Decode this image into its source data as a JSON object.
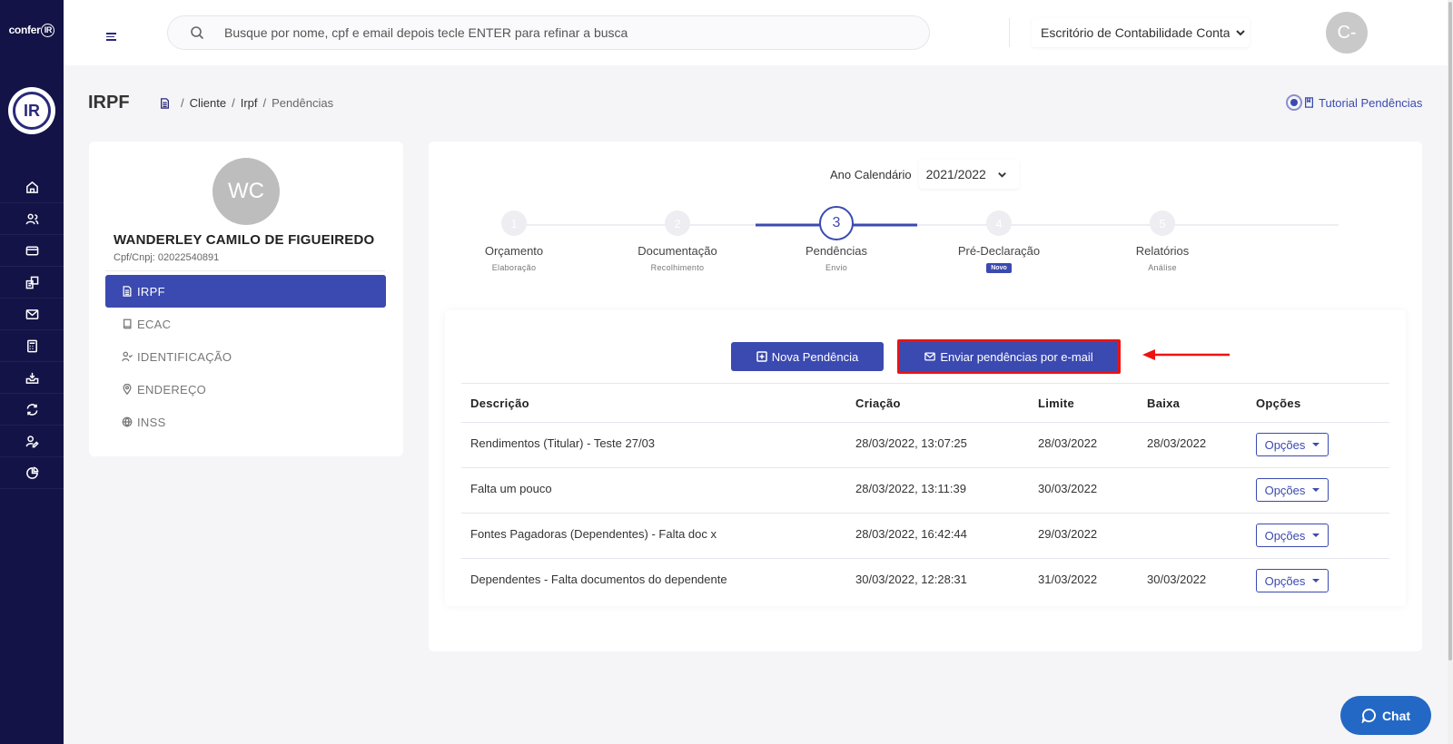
{
  "brand": {
    "logo_text": "confer",
    "logo_mark": "IR",
    "circle_mark": "IR"
  },
  "sidebar": {
    "icons": [
      "home-icon",
      "users-icon",
      "card-icon",
      "buildings-icon",
      "mail-icon",
      "calculator-icon",
      "inbox-tray-icon",
      "sync-icon",
      "user-edit-icon",
      "pie-chart-icon"
    ]
  },
  "topbar": {
    "search_placeholder": "Busque por nome, cpf e email depois tecle ENTER para refinar a busca",
    "company": "Escritório de Contabilidade Contabilidade",
    "user_initials": "C-"
  },
  "header": {
    "title": "IRPF",
    "breadcrumb": [
      "Cliente",
      "Irpf",
      "Pendências"
    ],
    "tutorial": "Tutorial Pendências"
  },
  "client": {
    "initials": "WC",
    "name": "WANDERLEY CAMILO DE FIGUEIREDO",
    "doc": "Cpf/Cnpj: 02022540891",
    "menu": [
      {
        "label": "IRPF",
        "icon": "document-icon",
        "active": true
      },
      {
        "label": "ECAC",
        "icon": "book-icon",
        "active": false
      },
      {
        "label": "IDENTIFICAÇÃO",
        "icon": "user-check-icon",
        "active": false
      },
      {
        "label": "ENDEREÇO",
        "icon": "map-pin-icon",
        "active": false
      },
      {
        "label": "INSS",
        "icon": "globe-icon",
        "active": false
      }
    ]
  },
  "main": {
    "year_label": "Ano Calendário",
    "year_value": "2021/2022",
    "steps": [
      {
        "number": "1",
        "label": "Orçamento",
        "sub": "Elaboração"
      },
      {
        "number": "2",
        "label": "Documentação",
        "sub": "Recolhimento"
      },
      {
        "number": "3",
        "label": "Pendências",
        "sub": "Envio"
      },
      {
        "number": "4",
        "label": "Pré-Declaração",
        "badge": "Novo"
      },
      {
        "number": "5",
        "label": "Relatórios",
        "sub": "Análise"
      }
    ],
    "active_step": 3,
    "new_button": "Nova Pendência",
    "email_button": "Enviar pendências por e-mail",
    "table": {
      "headers": [
        "Descrição",
        "Criação",
        "Limite",
        "Baixa",
        "Opções"
      ],
      "rows": [
        {
          "descricao": "Rendimentos (Titular) - Teste 27/03",
          "criacao": "28/03/2022, 13:07:25",
          "limite": "28/03/2022",
          "baixa": "28/03/2022",
          "opcoes": "Opções"
        },
        {
          "descricao": "Falta um pouco",
          "criacao": "28/03/2022, 13:11:39",
          "limite": "30/03/2022",
          "baixa": "",
          "opcoes": "Opções"
        },
        {
          "descricao": "Fontes Pagadoras (Dependentes) - Falta doc x",
          "criacao": "28/03/2022, 16:42:44",
          "limite": "29/03/2022",
          "baixa": "",
          "opcoes": "Opções"
        },
        {
          "descricao": "Dependentes - Falta documentos do dependente",
          "criacao": "30/03/2022, 12:28:31",
          "limite": "31/03/2022",
          "baixa": "30/03/2022",
          "opcoes": "Opções"
        }
      ]
    }
  },
  "chat": {
    "label": "Chat"
  },
  "colors": {
    "sidebar": "#131347",
    "accent": "#3b4ab0",
    "highlight": "#e11111",
    "chat": "#2468c5"
  }
}
